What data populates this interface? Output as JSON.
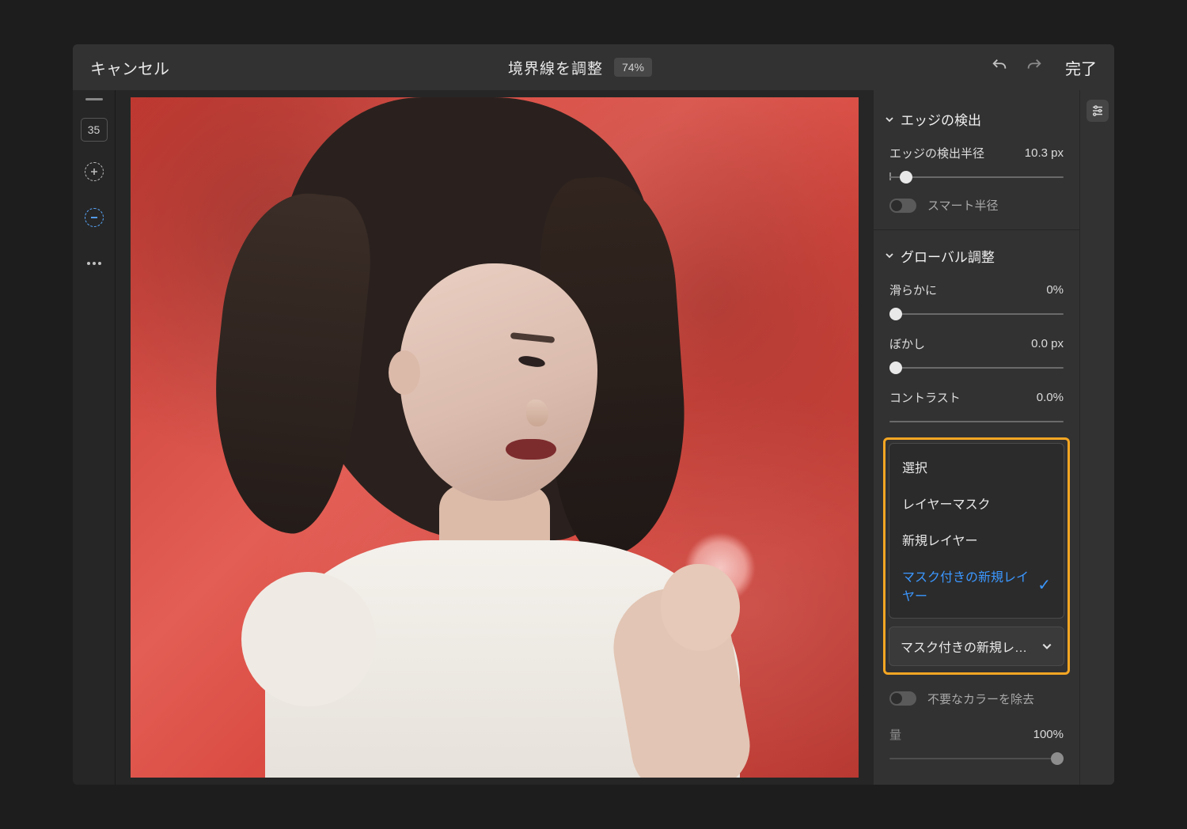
{
  "header": {
    "cancel": "キャンセル",
    "title": "境界線を調整",
    "zoom": "74%",
    "done": "完了"
  },
  "toolbar": {
    "brush_size": "35"
  },
  "panel": {
    "edge": {
      "title": "エッジの検出",
      "radius_label": "エッジの検出半径",
      "radius_value": "10.3 px",
      "smart_radius": "スマート半径",
      "slider_pos_pct": 6
    },
    "global": {
      "title": "グローバル調整",
      "smooth_label": "滑らかに",
      "smooth_value": "0%",
      "feather_label": "ぼかし",
      "feather_value": "0.0 px",
      "contrast_label": "コントラスト",
      "contrast_value": "0.0%"
    },
    "output": {
      "menu_items": [
        "選択",
        "レイヤーマスク",
        "新規レイヤー",
        "マスク付きの新規レイヤー"
      ],
      "selected_index": 3,
      "current_truncated": "マスク付きの新規レ…"
    },
    "decolor": {
      "label": "不要なカラーを除去",
      "amount_label": "量",
      "amount_value": "100%"
    }
  }
}
